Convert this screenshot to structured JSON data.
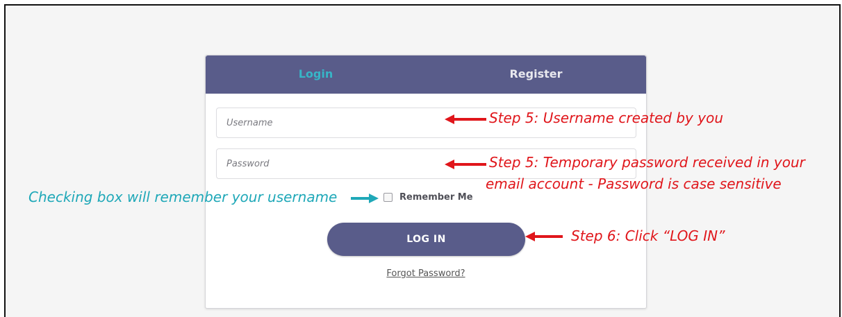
{
  "tabs": {
    "login": "Login",
    "register": "Register"
  },
  "form": {
    "username_placeholder": "Username",
    "password_placeholder": "Password",
    "remember_label": "Remember Me",
    "login_button": "LOG IN",
    "forgot_link": "Forgot Password?",
    "remember_checked": false
  },
  "annotations": {
    "username_note": "Step 5: Username created by you",
    "password_note_line1": "Step 5: Temporary password received in your",
    "password_note_line2": "email account - Password is case sensitive",
    "remember_note": "Checking box will remember your username",
    "login_note": "Step 6: Click “LOG IN”"
  },
  "colors": {
    "header": "#595c8a",
    "active_tab": "#37b5c7",
    "annotation_red": "#e0161b",
    "annotation_teal": "#1fa8b8"
  }
}
